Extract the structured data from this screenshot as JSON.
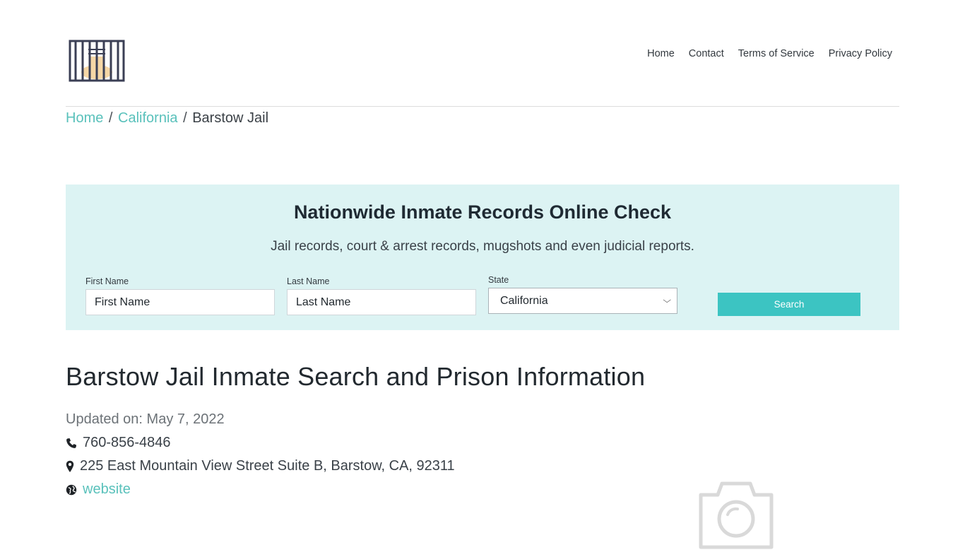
{
  "header": {
    "logo_name": "jail-cell-logo",
    "nav": [
      "Home",
      "Contact",
      "Terms of Service",
      "Privacy Policy"
    ]
  },
  "breadcrumb": {
    "items": [
      "Home",
      "California"
    ],
    "current": "Barstow Jail",
    "separator": "/"
  },
  "search_panel": {
    "title": "Nationwide Inmate Records Online Check",
    "subtitle": "Jail records, court & arrest records, mugshots and even judicial reports.",
    "first_name": {
      "label": "First Name",
      "placeholder": "First Name"
    },
    "last_name": {
      "label": "Last Name",
      "placeholder": "Last Name"
    },
    "state": {
      "label": "State",
      "selected": "California"
    },
    "button": "Search"
  },
  "main": {
    "title": "Barstow Jail Inmate Search and Prison Information",
    "updated": "Updated on: May 7, 2022",
    "phone": "760-856-4846",
    "address": "225 East Mountain View Street Suite B, Barstow, CA, 92311",
    "website": "website"
  },
  "colors": {
    "accent": "#3cc4c2",
    "link": "#59c1bb",
    "panel_bg": "#dcf3f3"
  },
  "icons": [
    "phone-icon",
    "map-marker-icon",
    "globe-icon",
    "camera-placeholder-icon"
  ]
}
